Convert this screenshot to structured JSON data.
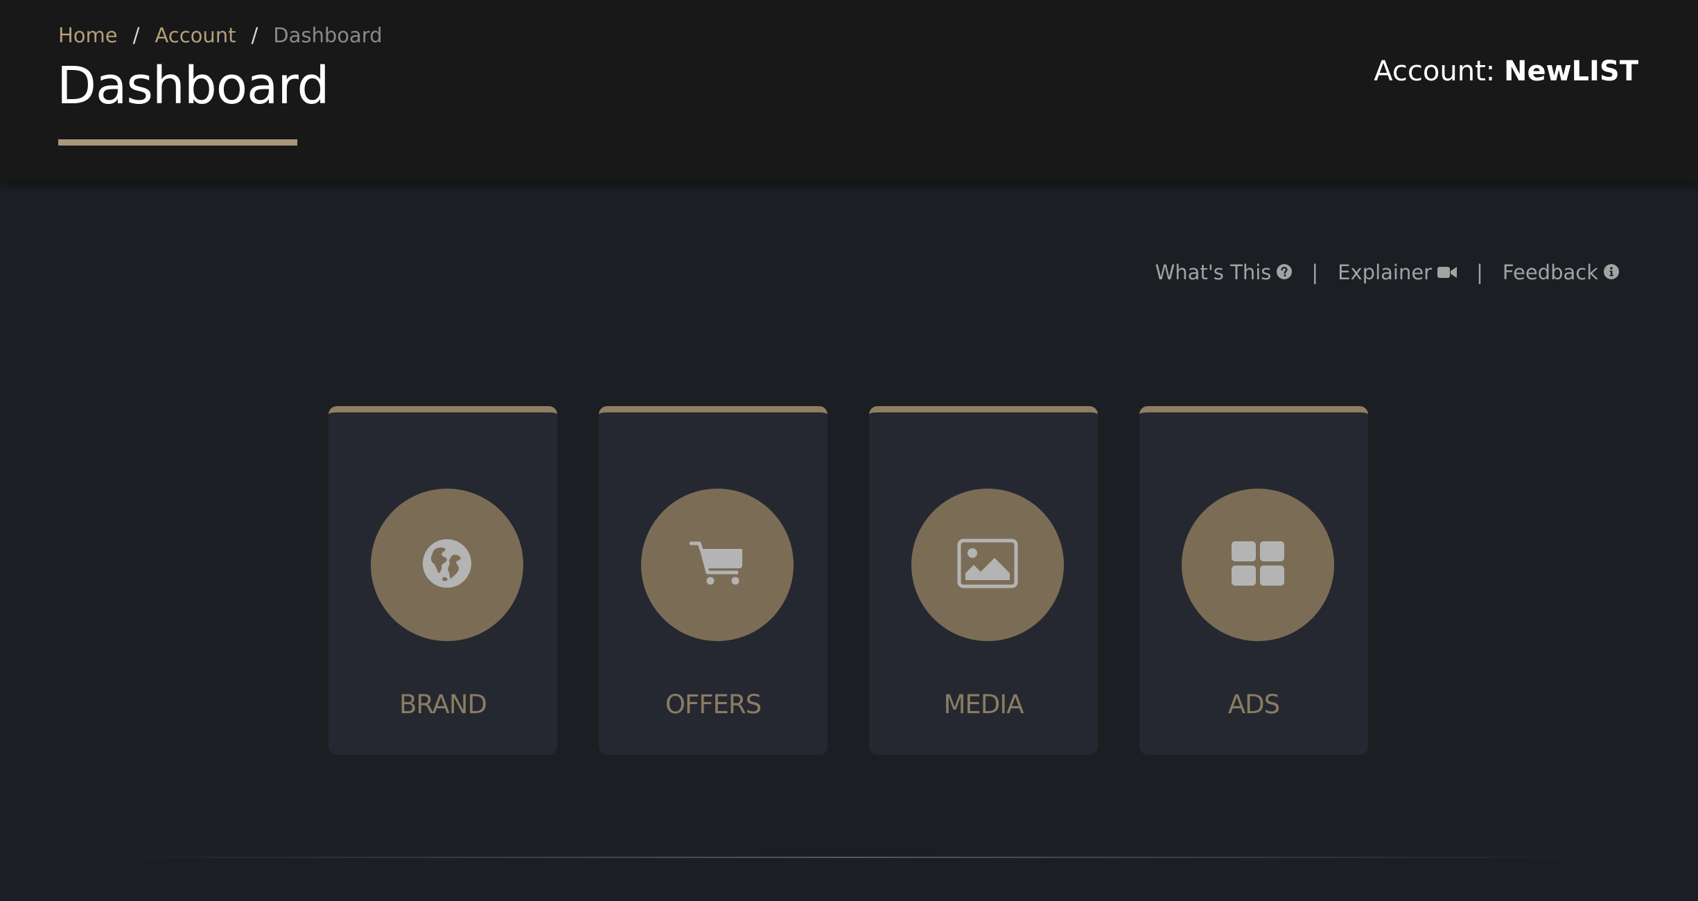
{
  "breadcrumb": {
    "home": "Home",
    "separator": "/",
    "account": "Account",
    "current": "Dashboard"
  },
  "header": {
    "title": "Dashboard",
    "account_label": "Account:",
    "account_name": "NewLIST"
  },
  "help_links": {
    "whats_this": "What's This",
    "explainer": "Explainer",
    "feedback": "Feedback",
    "separator": "|"
  },
  "cards": [
    {
      "label": "BRAND",
      "icon": "globe-icon"
    },
    {
      "label": "OFFERS",
      "icon": "shopping-cart-icon"
    },
    {
      "label": "MEDIA",
      "icon": "image-icon"
    },
    {
      "label": "ADS",
      "icon": "grid-icon"
    }
  ],
  "colors": {
    "accent": "#a8977a",
    "card_circle": "#7b6d55",
    "card_label": "#8b7c62",
    "icon": "#b4b4b4",
    "header_bg": "#181818",
    "page_bg": "#1b1e22",
    "card_bg": "#252830"
  }
}
